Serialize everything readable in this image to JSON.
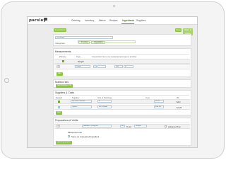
{
  "app": {
    "brand": "parsley"
  },
  "nav": {
    "items": [
      "Ordering",
      "Inventory",
      "Menus",
      "Recipes",
      "Ingredients",
      "Suppliers"
    ],
    "active": "Ingredients"
  },
  "header": {
    "left_button": "Ingredients",
    "save_label": "Save",
    "save_close_label": "Save & Close"
  },
  "ingredient": {
    "name": "Tomatoes",
    "categories_label": "Categories:",
    "categories": [
      "Produce",
      "Vegetables"
    ]
  },
  "measurements": {
    "title": "Measurements",
    "col_primary": "Primary",
    "col_type": "Type",
    "col_conversion": "Conversion from one measurement type to another",
    "row1_unit": "Weight",
    "row2_unit": "Count",
    "row2_value": "1",
    "row2_qty": "125",
    "row2_unit2": "g",
    "add_label": "Add"
  },
  "nutrition": {
    "title": "Nutrition Info",
    "button": "Add Nutrition Info"
  },
  "suppliers": {
    "title": "Suppliers & Costs",
    "headers": [
      "Default",
      "Supplier",
      "Unit of Purchase",
      "Cost",
      "Wt"
    ],
    "rows": [
      {
        "supplier": "Farmers Market",
        "unit": "lb",
        "cost": "$4.50",
        "wt": "$4.0"
      },
      {
        "supplier": "Sysco",
        "unit": "25 lb case",
        "cost": "$32.00",
        "wt": "$1.28"
      }
    ],
    "add_label": "Add"
  },
  "preparations": {
    "title": "Preparations & Yields",
    "name": "peeled & chopped",
    "yield_value": "82",
    "yield_unit": "% yld",
    "measure": "Weight",
    "advance_prep": "Advance Prep",
    "sub_title": "Measurements",
    "sub_note": "Same as unprepared ingredient",
    "add_label": "Add Preparation"
  }
}
